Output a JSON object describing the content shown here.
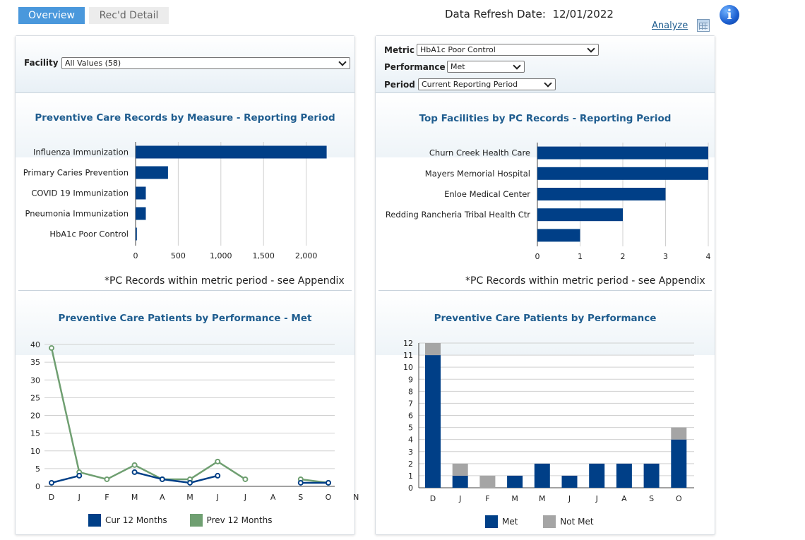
{
  "tabs": [
    {
      "label": "Overview"
    },
    {
      "label": "Rec'd Detail"
    }
  ],
  "header": {
    "refresh_label": "Data Refresh Date:",
    "refresh_date": "12/01/2022",
    "analyze_label": "Analyze"
  },
  "icons": {
    "calendar": "calendar-icon",
    "info": "info-icon",
    "info_glyph": "i"
  },
  "left_filters": {
    "facility_label": "Facility",
    "facility_value": "All Values (58)"
  },
  "right_filters": {
    "metric_label": "Metric",
    "metric_value": "HbA1c Poor Control",
    "performance_label": "Performance",
    "performance_value": "Met",
    "period_label": "Period",
    "period_value": "Current Reporting Period"
  },
  "colors": {
    "navy": "#003f87",
    "green": "#6f9f71",
    "gray": "#a5a5a5",
    "title": "#1f5d8f"
  },
  "chart_data": [
    {
      "id": "measure",
      "type": "bar",
      "orientation": "horizontal",
      "title": "Preventive Care Records by Measure - Reporting Period",
      "categories": [
        "Influenza Immunization",
        "Primary Caries Prevention",
        "COVID 19 Immunization",
        "Pneumonia Immunization",
        "HbA1c Poor Control"
      ],
      "values": [
        2240,
        380,
        120,
        120,
        15
      ],
      "xlim": [
        0,
        2500
      ],
      "xticks": [
        0,
        500,
        1000,
        1500,
        2000
      ],
      "xtick_labels": [
        "0",
        "500",
        "1,000",
        "1,500",
        "2,000"
      ],
      "grid": true,
      "footnote": "*PC Records within metric period - see Appendix"
    },
    {
      "id": "facilities",
      "type": "bar",
      "orientation": "horizontal",
      "title": "Top Facilities by PC Records - Reporting Period",
      "categories": [
        "Churn Creek Health Care",
        "Mayers Memorial Hospital",
        "Enloe Medical Center",
        "Redding Rancheria Tribal Health Ctr",
        ""
      ],
      "values": [
        4,
        4,
        3,
        2,
        1
      ],
      "xlim": [
        0,
        4
      ],
      "xticks": [
        0,
        1,
        2,
        3,
        4
      ],
      "xtick_labels": [
        "0",
        "1",
        "2",
        "3",
        "4"
      ],
      "grid": true,
      "footnote": "*PC Records within metric period - see Appendix"
    },
    {
      "id": "trend",
      "type": "line",
      "title": "Preventive Care Patients by Performance - Met",
      "categories": [
        "D",
        "J",
        "F",
        "M",
        "A",
        "M",
        "J",
        "J",
        "A",
        "S",
        "O",
        "N"
      ],
      "series": [
        {
          "name": "Cur 12 Months",
          "values": [
            1,
            3,
            null,
            4,
            2,
            1,
            3,
            null,
            null,
            1,
            1,
            null
          ]
        },
        {
          "name": "Prev 12 Months",
          "values": [
            39,
            4,
            2,
            6,
            2,
            2,
            7,
            2,
            null,
            2,
            1,
            null
          ]
        }
      ],
      "ylim": [
        0,
        40
      ],
      "yticks": [
        0,
        5,
        10,
        15,
        20,
        25,
        30,
        35,
        40
      ],
      "grid": true,
      "legend": "bottom"
    },
    {
      "id": "performance",
      "type": "bar",
      "stacked": true,
      "title": "Preventive Care Patients by Performance",
      "categories": [
        "D",
        "J",
        "F",
        "M",
        "M",
        "J",
        "J",
        "A",
        "S",
        "O"
      ],
      "series": [
        {
          "name": "Met",
          "values": [
            11,
            1,
            0,
            1,
            2,
            1,
            2,
            2,
            2,
            4
          ]
        },
        {
          "name": "Not Met",
          "values": [
            1,
            1,
            1,
            0,
            0,
            0,
            0,
            0,
            0,
            1
          ]
        }
      ],
      "ylim": [
        0,
        12
      ],
      "yticks": [
        0,
        1,
        2,
        3,
        4,
        5,
        6,
        7,
        8,
        9,
        10,
        11,
        12
      ],
      "grid": true,
      "legend": "bottom"
    }
  ]
}
